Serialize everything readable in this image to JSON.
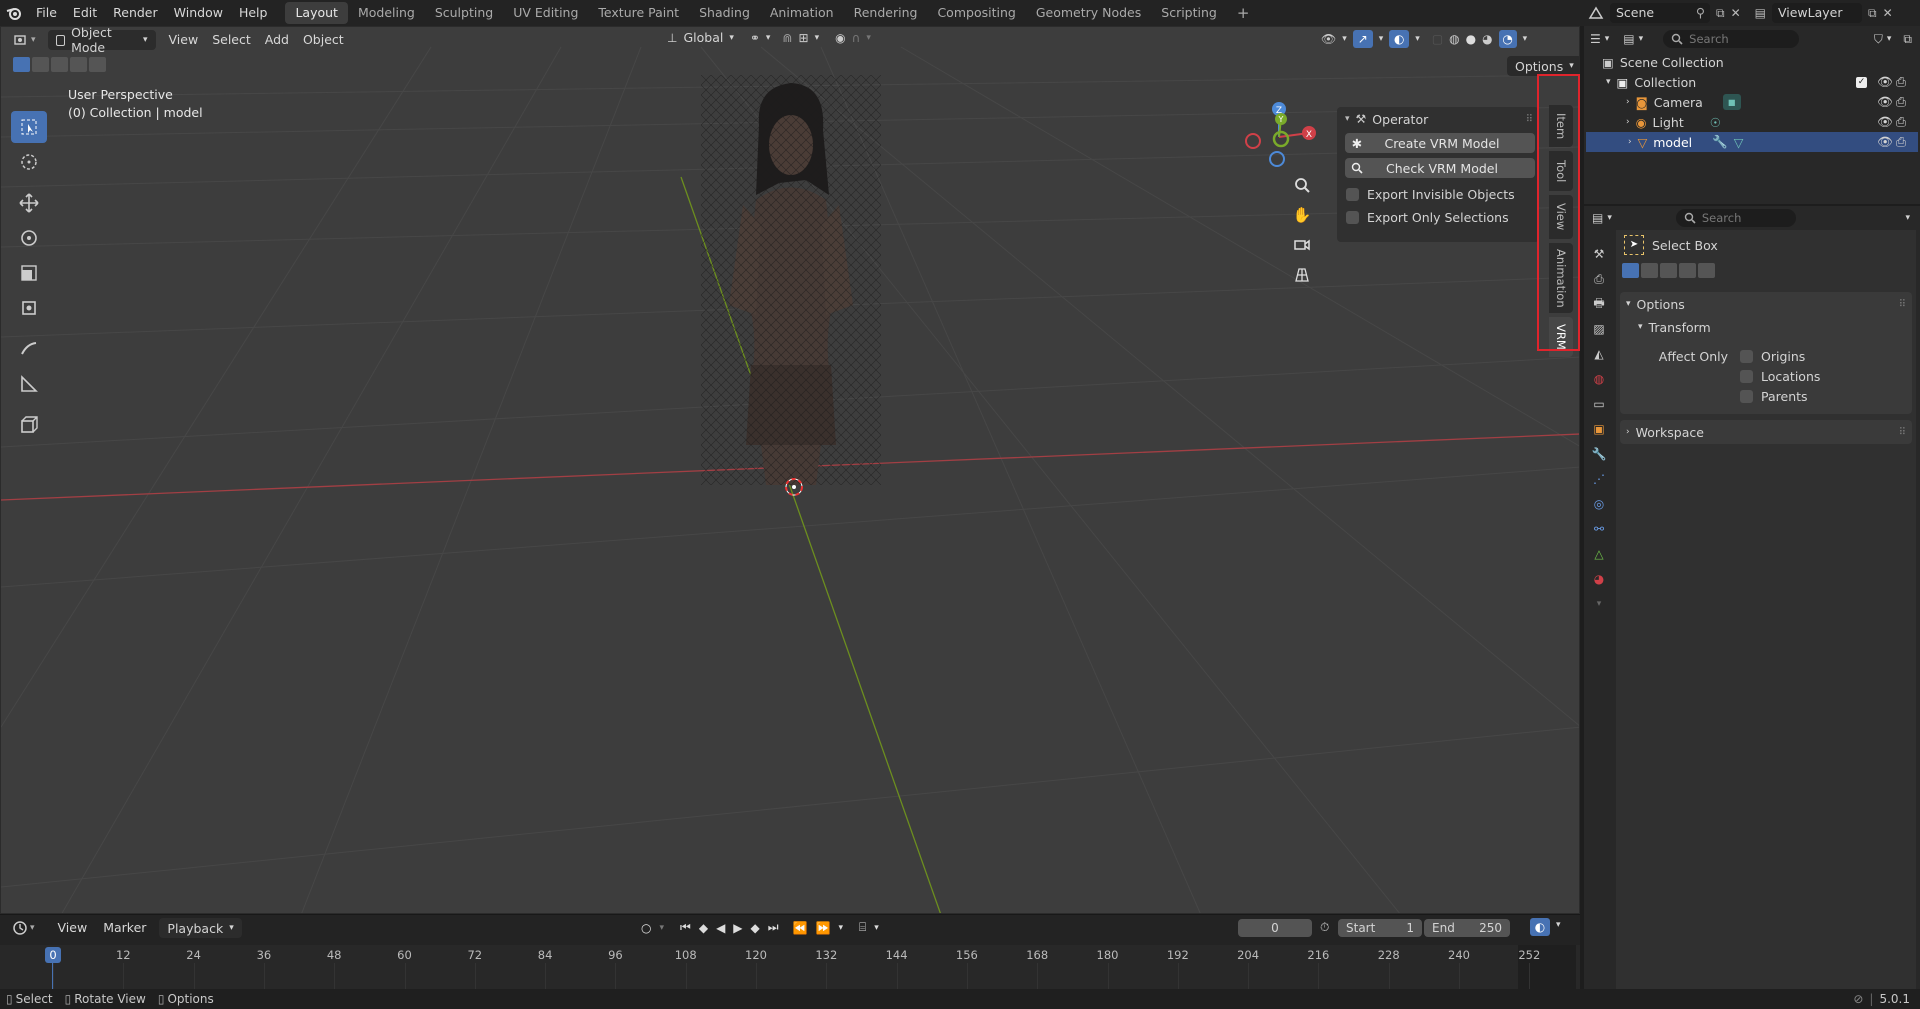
{
  "app": {
    "accent": "#4772b3",
    "highlight": "#e0242c"
  },
  "menu": {
    "file": "File",
    "edit": "Edit",
    "render": "Render",
    "window": "Window",
    "help": "Help"
  },
  "workspaces": [
    "Layout",
    "Modeling",
    "Sculpting",
    "UV Editing",
    "Texture Paint",
    "Shading",
    "Animation",
    "Rendering",
    "Compositing",
    "Geometry Nodes",
    "Scripting"
  ],
  "top_right": {
    "scene": "Scene",
    "search_placeholder": "Search",
    "viewlayer": "ViewLayer"
  },
  "viewport": {
    "mode": "Object Mode",
    "view": "View",
    "select": "Select",
    "add": "Add",
    "object": "Object",
    "orientation": "Global",
    "options": "Options",
    "perspective": "User Perspective",
    "collection_info": "(0) Collection | model",
    "gizmo": {
      "x": "X",
      "y": "Y",
      "z": "Z"
    }
  },
  "npanel": {
    "title": "Operator",
    "create": "Create VRM Model",
    "check": "Check VRM Model",
    "export_invisible": "Export Invisible Objects",
    "export_selections": "Export Only Selections",
    "tabs": [
      "Item",
      "Tool",
      "View",
      "Animation",
      "VRM"
    ]
  },
  "timeline": {
    "view": "View",
    "marker": "Marker",
    "playback": "Playback",
    "current_frame": "0",
    "start_label": "Start",
    "start": "1",
    "end_label": "End",
    "end": "250",
    "ruler": [
      "0",
      "12",
      "24",
      "36",
      "48",
      "60",
      "72",
      "84",
      "96",
      "108",
      "120",
      "132",
      "144",
      "156",
      "168",
      "180",
      "192",
      "204",
      "216",
      "228",
      "240",
      "252"
    ]
  },
  "status": {
    "select": "Select",
    "rotate": "Rotate View",
    "options": "Options",
    "version": "5.0.1"
  },
  "outliner": {
    "search_placeholder": "Search",
    "scene_collection": "Scene Collection",
    "collection": "Collection",
    "items": [
      "Camera",
      "Light",
      "model"
    ]
  },
  "properties": {
    "search_placeholder": "Search",
    "tool_name": "Select Box",
    "options": "Options",
    "transform": "Transform",
    "affect_only": "Affect Only",
    "origins": "Origins",
    "locations": "Locations",
    "parents": "Parents",
    "workspace": "Workspace"
  }
}
